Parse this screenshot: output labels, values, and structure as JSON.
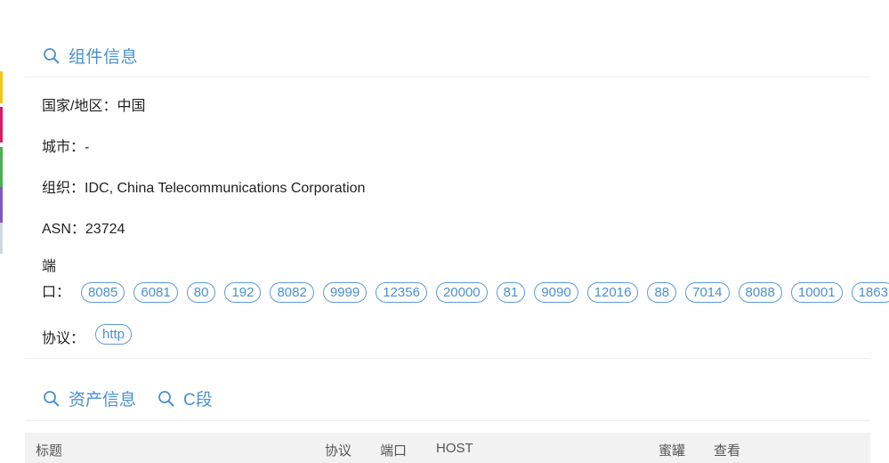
{
  "component_section": {
    "title": "组件信息",
    "country": {
      "label": "国家/地区：",
      "value": "中国"
    },
    "city": {
      "label": "城市：",
      "value": "-"
    },
    "org": {
      "label": "组织：",
      "value": "IDC, China Telecommunications Corporation"
    },
    "asn": {
      "label": "ASN：",
      "value": "23724"
    },
    "port_label_line1": "端",
    "port_label_line2": "口：",
    "ports": [
      "8085",
      "6081",
      "80",
      "192",
      "8082",
      "9999",
      "12356",
      "20000",
      "81",
      "9090",
      "12016",
      "88",
      "7014",
      "8088",
      "10001",
      "1863"
    ],
    "protocol_label": "协议：",
    "protocols": [
      "http"
    ]
  },
  "asset_tabs": {
    "asset_info": "资产信息",
    "c_segment": "C段"
  },
  "table": {
    "headers": [
      "标题",
      "协议",
      "端口",
      "HOST",
      "蜜罐",
      "查看"
    ]
  },
  "colors": {
    "accent": "#4a90d0",
    "pill_border": "#5b9bd8",
    "header_bg": "#f2f2f2"
  }
}
